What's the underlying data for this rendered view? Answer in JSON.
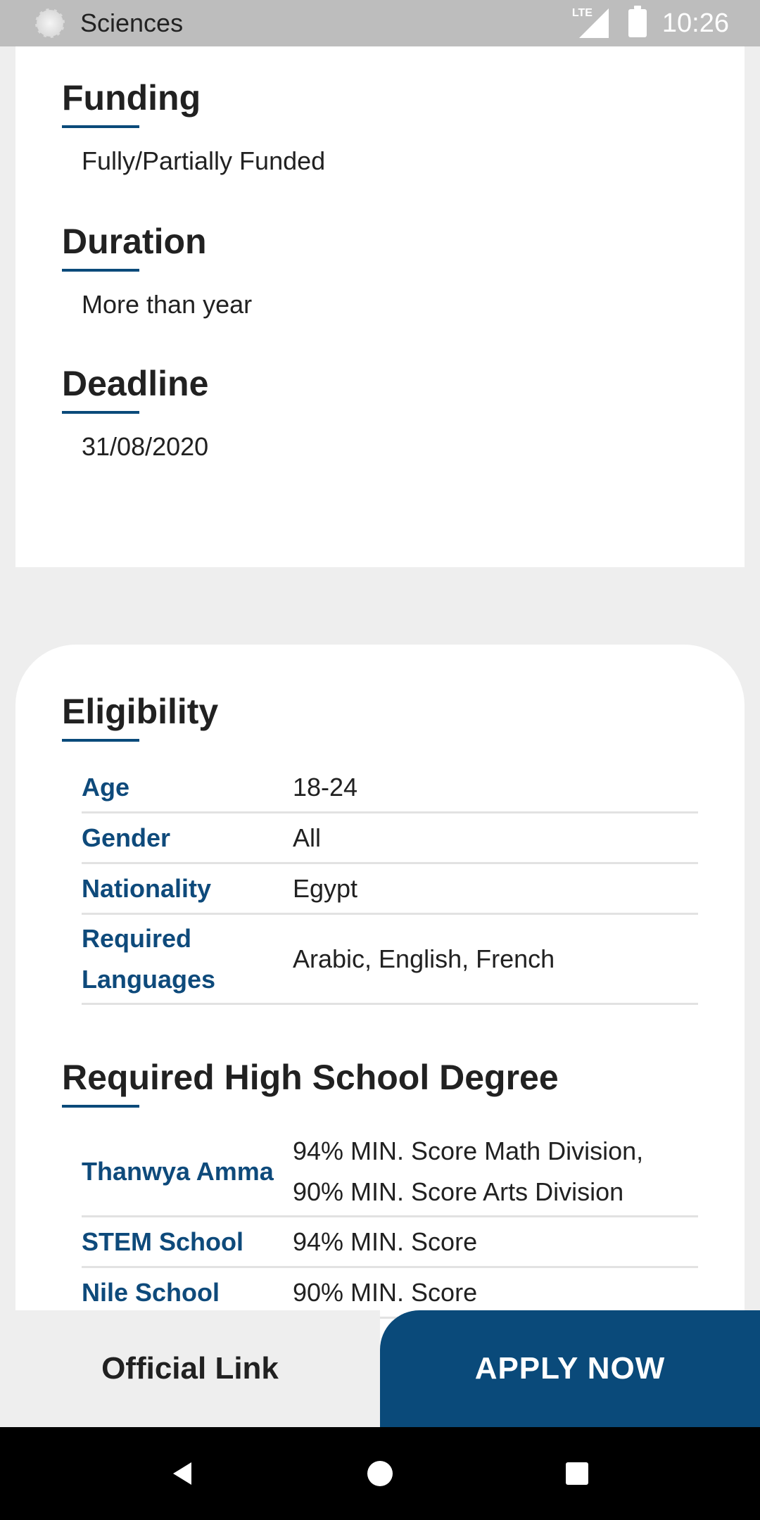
{
  "status_bar": {
    "app_title": "Sciences",
    "network_label": "LTE",
    "time": "10:26"
  },
  "details": {
    "funding": {
      "heading": "Funding",
      "value": "Fully/Partially Funded"
    },
    "duration": {
      "heading": "Duration",
      "value": "More than year"
    },
    "deadline": {
      "heading": "Deadline",
      "value": "31/08/2020"
    }
  },
  "eligibility": {
    "heading": "Eligibility",
    "rows": [
      {
        "label": "Age",
        "value": "18-24"
      },
      {
        "label": "Gender",
        "value": "All"
      },
      {
        "label": "Nationality",
        "value": "Egypt"
      },
      {
        "label": "Required Languages",
        "value": "Arabic, English, French"
      }
    ]
  },
  "high_school": {
    "heading": "Required High School Degree",
    "rows": [
      {
        "label": "Thanwya Amma",
        "value": "94% MIN. Score Math Division, 90% MIN. Score Arts Division"
      },
      {
        "label": "STEM School",
        "value": "94% MIN. Score"
      },
      {
        "label": "Nile School",
        "value": "90% MIN. Score"
      }
    ]
  },
  "actions": {
    "official_link": "Official Link",
    "apply_now": "APPLY NOW"
  },
  "colors": {
    "accent": "#0a4a7a",
    "label_blue": "#0e4a7b",
    "background": "#eeeeee"
  }
}
